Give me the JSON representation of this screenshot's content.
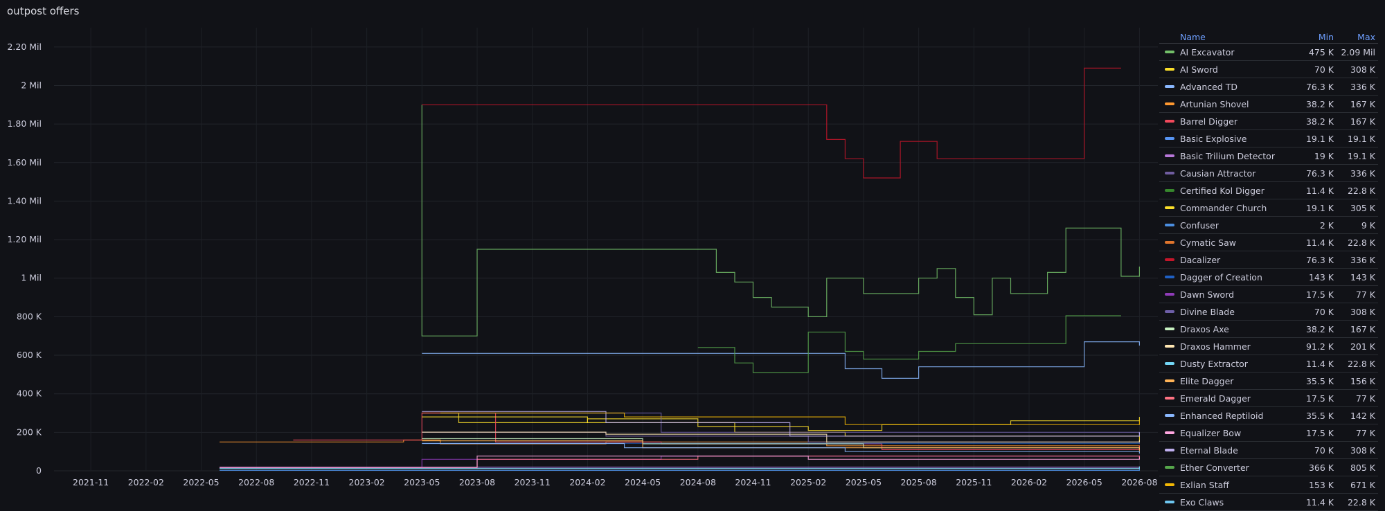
{
  "panel": {
    "title": "outpost offers"
  },
  "legend": {
    "header": {
      "name": "Name",
      "min": "Min",
      "max": "Max"
    }
  },
  "chart_data": {
    "type": "line",
    "ylim": [
      0,
      2300000
    ],
    "yticks": [
      {
        "label": "0",
        "value": 0
      },
      {
        "label": "200 K",
        "value": 200000
      },
      {
        "label": "400 K",
        "value": 400000
      },
      {
        "label": "600 K",
        "value": 600000
      },
      {
        "label": "800 K",
        "value": 800000
      },
      {
        "label": "1 Mil",
        "value": 1000000
      },
      {
        "label": "1.20 Mil",
        "value": 1200000
      },
      {
        "label": "1.40 Mil",
        "value": 1400000
      },
      {
        "label": "1.60 Mil",
        "value": 1600000
      },
      {
        "label": "1.80 Mil",
        "value": 1800000
      },
      {
        "label": "2 Mil",
        "value": 2000000
      },
      {
        "label": "2.20 Mil",
        "value": 2200000
      }
    ],
    "xlim": [
      "2021-09",
      "2026-09"
    ],
    "xticks": [
      "2021-11",
      "2022-02",
      "2022-05",
      "2022-08",
      "2022-11",
      "2023-02",
      "2023-05",
      "2023-08",
      "2023-11",
      "2024-02",
      "2024-05",
      "2024-08",
      "2024-11",
      "2025-02",
      "2025-05",
      "2025-08",
      "2025-11",
      "2026-02",
      "2026-05",
      "2026-08"
    ],
    "series": [
      {
        "name": "AI Excavator",
        "color": "#73bf69",
        "min": "475 K",
        "max": "2.09 Mil",
        "points": [
          [
            "2023-05",
            1900000
          ],
          [
            "2023-05",
            700000
          ],
          [
            "2023-08",
            1150000
          ],
          [
            "2024-01",
            1150000
          ],
          [
            "2024-08",
            1150000
          ],
          [
            "2024-09",
            1030000
          ],
          [
            "2024-10",
            980000
          ],
          [
            "2024-11",
            900000
          ],
          [
            "2024-12",
            850000
          ],
          [
            "2025-02",
            800000
          ],
          [
            "2025-03",
            1000000
          ],
          [
            "2025-05",
            920000
          ],
          [
            "2025-08",
            1000000
          ],
          [
            "2025-09",
            1050000
          ],
          [
            "2025-10",
            900000
          ],
          [
            "2025-11",
            810000
          ],
          [
            "2025-12",
            1000000
          ],
          [
            "2026-01",
            920000
          ],
          [
            "2026-03",
            1030000
          ],
          [
            "2026-04",
            1260000
          ],
          [
            "2026-07",
            1010000
          ],
          [
            "2026-08",
            1060000
          ]
        ]
      },
      {
        "name": "AI Sword",
        "color": "#fade2a",
        "min": "70 K",
        "max": "308 K",
        "points": [
          [
            "2023-05",
            300000
          ],
          [
            "2023-07",
            250000
          ],
          [
            "2024-02",
            270000
          ],
          [
            "2024-08",
            230000
          ],
          [
            "2025-02",
            210000
          ],
          [
            "2025-06",
            240000
          ],
          [
            "2026-01",
            260000
          ],
          [
            "2026-08",
            280000
          ]
        ]
      },
      {
        "name": "Advanced TD",
        "color": "#8ab8ff",
        "min": "76.3 K",
        "max": "336 K",
        "points": [
          [
            "2023-05",
            610000
          ],
          [
            "2023-09",
            610000
          ],
          [
            "2024-02",
            610000
          ],
          [
            "2024-07",
            610000
          ],
          [
            "2025-02",
            610000
          ],
          [
            "2025-04",
            530000
          ],
          [
            "2025-06",
            480000
          ],
          [
            "2025-08",
            540000
          ],
          [
            "2026-05",
            670000
          ],
          [
            "2026-08",
            650000
          ]
        ]
      },
      {
        "name": "Artunian Shovel",
        "color": "#ff9830",
        "min": "38.2 K",
        "max": "167 K",
        "points": [
          [
            "2022-06",
            150000
          ],
          [
            "2023-04",
            160000
          ],
          [
            "2023-06",
            140000
          ],
          [
            "2024-03",
            150000
          ],
          [
            "2025-03",
            130000
          ],
          [
            "2026-08",
            120000
          ]
        ]
      },
      {
        "name": "Barrel Digger",
        "color": "#f2495c",
        "min": "38.2 K",
        "max": "167 K",
        "points": [
          [
            "2022-10",
            160000
          ],
          [
            "2023-05",
            300000
          ],
          [
            "2023-09",
            150000
          ],
          [
            "2024-06",
            140000
          ],
          [
            "2025-06",
            110000
          ],
          [
            "2026-08",
            130000
          ]
        ]
      },
      {
        "name": "Basic Explosive",
        "color": "#5794f2",
        "min": "19.1 K",
        "max": "19.1 K",
        "points": [
          [
            "2022-06",
            19100
          ],
          [
            "2026-08",
            19100
          ]
        ]
      },
      {
        "name": "Basic Trilium Detector",
        "color": "#b877d9",
        "min": "19 K",
        "max": "19.1 K",
        "points": [
          [
            "2022-06",
            19000
          ],
          [
            "2026-08",
            19100
          ]
        ]
      },
      {
        "name": "Causian Attractor",
        "color": "#705da0",
        "min": "76.3 K",
        "max": "336 K",
        "points": [
          [
            "2023-05",
            200000
          ],
          [
            "2024-03",
            180000
          ],
          [
            "2025-02",
            150000
          ],
          [
            "2026-08",
            140000
          ]
        ]
      },
      {
        "name": "Certified Kol Digger",
        "color": "#37872d",
        "min": "11.4 K",
        "max": "22.8 K",
        "points": [
          [
            "2022-06",
            11400
          ],
          [
            "2026-08",
            22800
          ]
        ]
      },
      {
        "name": "Commander Church",
        "color": "#fade2a",
        "min": "19.1 K",
        "max": "305 K",
        "points": [
          [
            "2023-05",
            280000
          ],
          [
            "2024-02",
            250000
          ],
          [
            "2024-10",
            200000
          ],
          [
            "2025-04",
            180000
          ],
          [
            "2026-08",
            150000
          ]
        ]
      },
      {
        "name": "Confuser",
        "color": "#4b8ee0",
        "min": "2 K",
        "max": "9 K",
        "points": [
          [
            "2022-06",
            2000
          ],
          [
            "2026-08",
            9000
          ]
        ]
      },
      {
        "name": "Cymatic Saw",
        "color": "#e0752d",
        "min": "11.4 K",
        "max": "22.8 K",
        "points": [
          [
            "2022-06",
            11400
          ],
          [
            "2026-08",
            22800
          ]
        ]
      },
      {
        "name": "Dacalizer",
        "color": "#c4162a",
        "min": "76.3 K",
        "max": "336 K",
        "points": [
          [
            "2023-05",
            1900000
          ],
          [
            "2023-08",
            1900000
          ],
          [
            "2024-05",
            1900000
          ],
          [
            "2025-02",
            1900000
          ],
          [
            "2025-03",
            1720000
          ],
          [
            "2025-04",
            1620000
          ],
          [
            "2025-05",
            1520000
          ],
          [
            "2025-07",
            1710000
          ],
          [
            "2025-09",
            1620000
          ],
          [
            "2026-05",
            2090000
          ],
          [
            "2026-07",
            2090000
          ]
        ]
      },
      {
        "name": "Dagger of Creation",
        "color": "#1f60c4",
        "min": "143 K",
        "max": "143 K",
        "points": [
          [
            "2023-05",
            143000
          ],
          [
            "2026-08",
            143000
          ]
        ]
      },
      {
        "name": "Dawn Sword",
        "color": "#8f3bb8",
        "min": "17.5 K",
        "max": "77 K",
        "points": [
          [
            "2022-06",
            17500
          ],
          [
            "2023-05",
            60000
          ],
          [
            "2024-06",
            77000
          ],
          [
            "2026-08",
            70000
          ]
        ]
      },
      {
        "name": "Divine Blade",
        "color": "#6e5fa8",
        "min": "70 K",
        "max": "308 K",
        "points": [
          [
            "2023-06",
            300000
          ],
          [
            "2024-06",
            200000
          ],
          [
            "2026-08",
            190000
          ]
        ]
      },
      {
        "name": "Draxos Axe",
        "color": "#c8f2c2",
        "min": "38.2 K",
        "max": "167 K",
        "points": [
          [
            "2023-05",
            167000
          ],
          [
            "2024-05",
            140000
          ],
          [
            "2025-05",
            120000
          ],
          [
            "2026-08",
            110000
          ]
        ]
      },
      {
        "name": "Draxos Hammer",
        "color": "#ffe7b3",
        "min": "91.2 K",
        "max": "201 K",
        "points": [
          [
            "2023-05",
            201000
          ],
          [
            "2024-03",
            190000
          ],
          [
            "2025-03",
            150000
          ],
          [
            "2026-08",
            160000
          ]
        ]
      },
      {
        "name": "Dusty Extractor",
        "color": "#73d6f5",
        "min": "11.4 K",
        "max": "22.8 K",
        "points": [
          [
            "2022-06",
            11400
          ],
          [
            "2026-08",
            22800
          ]
        ]
      },
      {
        "name": "Elite Dagger",
        "color": "#ffb357",
        "min": "35.5 K",
        "max": "156 K",
        "points": [
          [
            "2023-05",
            156000
          ],
          [
            "2024-05",
            120000
          ],
          [
            "2026-08",
            100000
          ]
        ]
      },
      {
        "name": "Emerald Dagger",
        "color": "#ff7383",
        "min": "17.5 K",
        "max": "77 K",
        "points": [
          [
            "2022-06",
            17500
          ],
          [
            "2023-08",
            60000
          ],
          [
            "2024-08",
            77000
          ],
          [
            "2026-08",
            60000
          ]
        ]
      },
      {
        "name": "Enhanced Reptiloid",
        "color": "#8ab8ff",
        "min": "35.5 K",
        "max": "142 K",
        "points": [
          [
            "2023-05",
            142000
          ],
          [
            "2024-04",
            120000
          ],
          [
            "2025-04",
            100000
          ],
          [
            "2026-08",
            90000
          ]
        ]
      },
      {
        "name": "Equalizer Bow",
        "color": "#ffa6e0",
        "min": "17.5 K",
        "max": "77 K",
        "points": [
          [
            "2022-06",
            17500
          ],
          [
            "2023-08",
            77000
          ],
          [
            "2025-02",
            60000
          ],
          [
            "2026-08",
            70000
          ]
        ]
      },
      {
        "name": "Eternal Blade",
        "color": "#c0b0f0",
        "min": "70 K",
        "max": "308 K",
        "points": [
          [
            "2023-05",
            308000
          ],
          [
            "2024-03",
            250000
          ],
          [
            "2025-01",
            180000
          ],
          [
            "2026-08",
            200000
          ]
        ]
      },
      {
        "name": "Ether Converter",
        "color": "#56a64b",
        "min": "366 K",
        "max": "805 K",
        "points": [
          [
            "2024-08",
            640000
          ],
          [
            "2024-10",
            560000
          ],
          [
            "2024-11",
            510000
          ],
          [
            "2025-02",
            720000
          ],
          [
            "2025-04",
            620000
          ],
          [
            "2025-05",
            580000
          ],
          [
            "2025-08",
            620000
          ],
          [
            "2025-10",
            660000
          ],
          [
            "2026-04",
            805000
          ],
          [
            "2026-07",
            805000
          ]
        ]
      },
      {
        "name": "Exlian Staff",
        "color": "#f2b705",
        "min": "153 K",
        "max": "671 K",
        "points": [
          [
            "2023-06",
            300000
          ],
          [
            "2024-04",
            280000
          ],
          [
            "2025-04",
            240000
          ],
          [
            "2026-08",
            260000
          ]
        ]
      },
      {
        "name": "Exo Claws",
        "color": "#6ec6f0",
        "min": "11.4 K",
        "max": "22.8 K",
        "points": [
          [
            "2022-06",
            11400
          ],
          [
            "2026-08",
            22800
          ]
        ]
      }
    ]
  }
}
